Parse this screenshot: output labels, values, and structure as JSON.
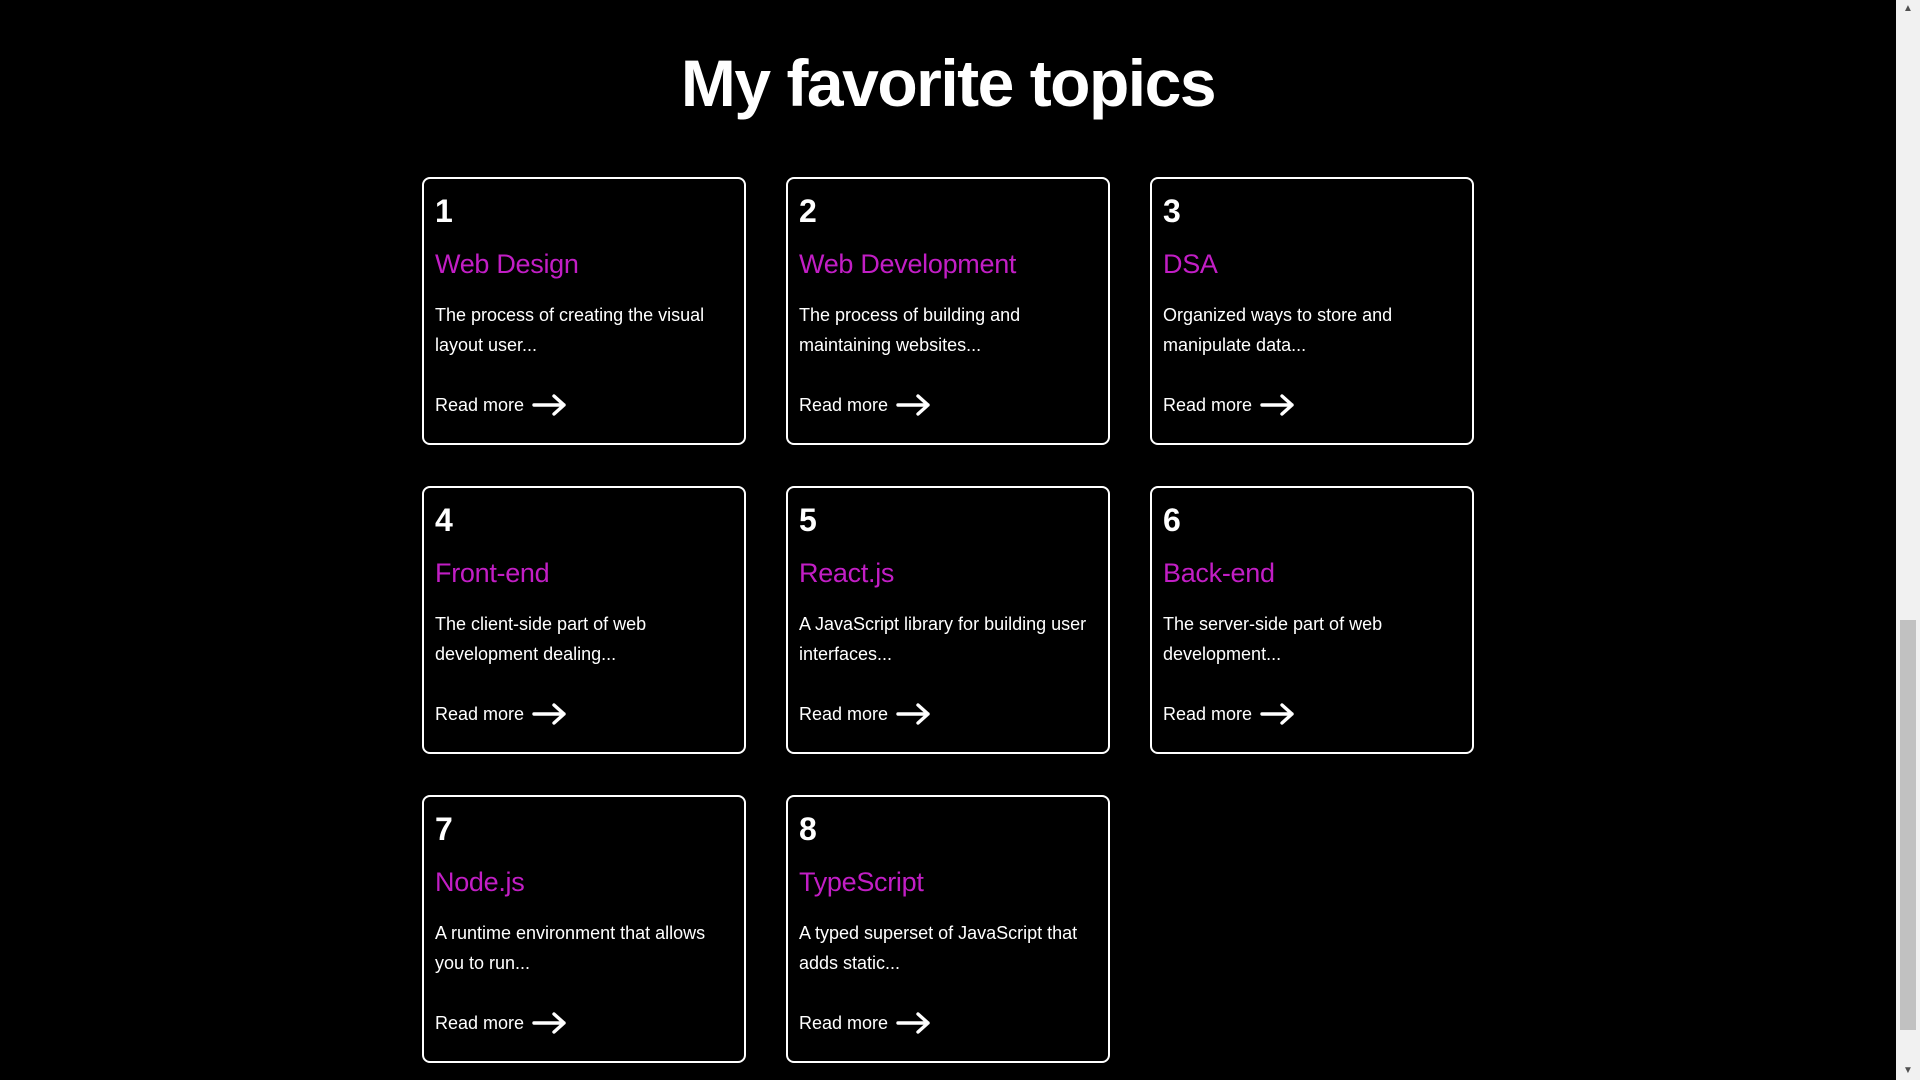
{
  "heading": "My favorite topics",
  "colors": {
    "accent": "#c21ec5",
    "background": "#000000",
    "blob": "#ff3d36"
  },
  "read_more_label": "Read more",
  "cards": [
    {
      "number": "1",
      "title": "Web Design",
      "description": "The process of creating the visual layout user..."
    },
    {
      "number": "2",
      "title": "Web Development",
      "description": "The process of building and maintaining websites..."
    },
    {
      "number": "3",
      "title": "DSA",
      "description": "Organized ways to store and manipulate data..."
    },
    {
      "number": "4",
      "title": "Front-end",
      "description": "The client-side part of web development dealing..."
    },
    {
      "number": "5",
      "title": "React.js",
      "description": "A JavaScript library for building user interfaces..."
    },
    {
      "number": "6",
      "title": "Back-end",
      "description": "The server-side part of web development..."
    },
    {
      "number": "7",
      "title": "Node.js",
      "description": "A runtime environment that allows you to run..."
    },
    {
      "number": "8",
      "title": "TypeScript",
      "description": "A typed superset of JavaScript that adds static..."
    }
  ],
  "icons": {
    "read_more": "arrow-right-icon"
  }
}
